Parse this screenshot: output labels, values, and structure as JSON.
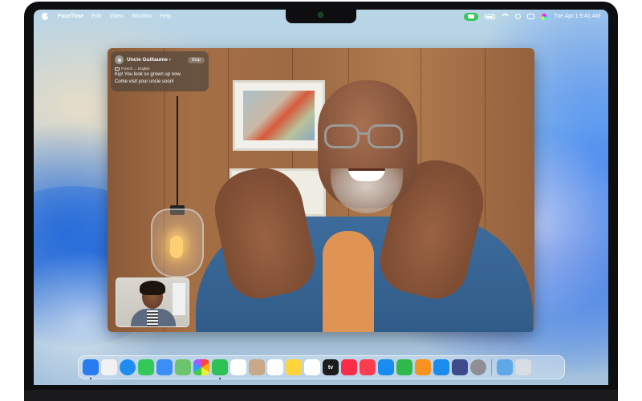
{
  "menubar": {
    "app_name": "FaceTime",
    "items": [
      "Edit",
      "Video",
      "Window",
      "Help"
    ],
    "datetime": "Tue Apr 1  9:41 AM"
  },
  "notification": {
    "caller": "Uncle Guillaume ›",
    "stop_label": "Stop",
    "languages": "French → English",
    "translation": [
      "Kip! You look so grown up now.",
      "Come visit your uncle soon!"
    ]
  },
  "dock": {
    "apps": [
      {
        "name": "finder-icon",
        "color": "#2a7bf0"
      },
      {
        "name": "launchpad-icon",
        "color": "#f1f1f4"
      },
      {
        "name": "safari-icon",
        "color": "#1e8cf0"
      },
      {
        "name": "messages-icon",
        "color": "#34c759"
      },
      {
        "name": "mail-icon",
        "color": "#3a8ef5"
      },
      {
        "name": "maps-icon",
        "color": "#6cc56d"
      },
      {
        "name": "photos-icon",
        "color": "#ffffff"
      },
      {
        "name": "facetime-icon",
        "color": "#30c155"
      },
      {
        "name": "calendar-icon",
        "color": "#ffffff"
      },
      {
        "name": "contacts-icon",
        "color": "#c8a886"
      },
      {
        "name": "reminders-icon",
        "color": "#ffffff"
      },
      {
        "name": "notes-icon",
        "color": "#ffd43b"
      },
      {
        "name": "freeform-icon",
        "color": "#ffffff"
      },
      {
        "name": "tv-icon",
        "color": "#1c1c1e"
      },
      {
        "name": "music-icon",
        "color": "#fa2d48"
      },
      {
        "name": "news-icon",
        "color": "#fc3d50"
      },
      {
        "name": "keynote-icon",
        "color": "#1a8cf0"
      },
      {
        "name": "numbers-icon",
        "color": "#2fb94b"
      },
      {
        "name": "pages-icon",
        "color": "#f7931e"
      },
      {
        "name": "app-store-icon",
        "color": "#1a8cf0"
      },
      {
        "name": "iphone-mirroring-icon",
        "color": "#3e4a8c"
      },
      {
        "name": "system-settings-icon",
        "color": "#8e8e93"
      },
      {
        "name": "downloads-folder-icon",
        "color": "#5fa8e8"
      },
      {
        "name": "trash-icon",
        "color": "#d8dde4"
      }
    ],
    "tv_label": "tv"
  }
}
